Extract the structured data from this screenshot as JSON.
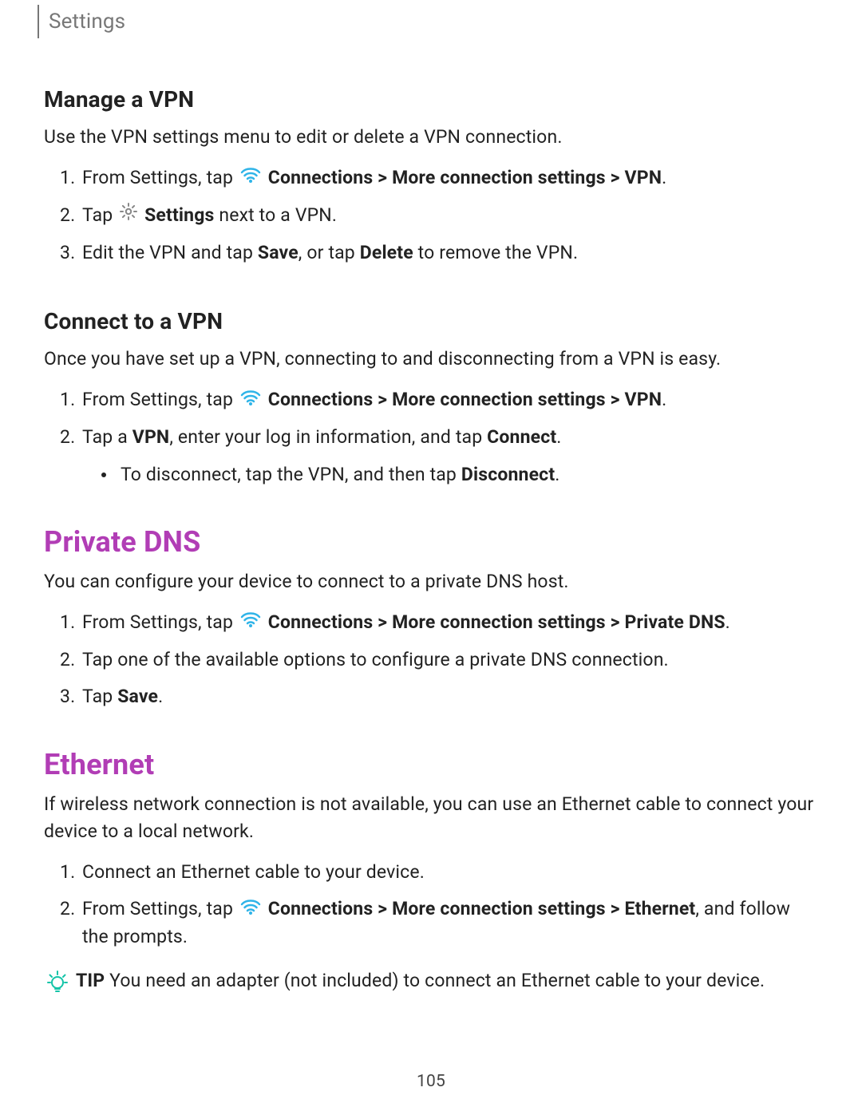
{
  "header": {
    "title": "Settings"
  },
  "manage_vpn": {
    "heading": "Manage a VPN",
    "intro": "Use the VPN settings menu to edit or delete a VPN connection.",
    "step1_a": "From  Settings, tap ",
    "step1_b": " Connections > More connection settings > VPN",
    "step1_c": ".",
    "step2_a": "Tap ",
    "step2_b": " Settings",
    "step2_c": " next to a VPN.",
    "step3_a": "Edit the VPN and tap ",
    "step3_b": "Save",
    "step3_c": ", or tap ",
    "step3_d": "Delete",
    "step3_e": " to remove the VPN."
  },
  "connect_vpn": {
    "heading": "Connect to a VPN",
    "intro": "Once you have set up a VPN, connecting to and disconnecting from a VPN is easy.",
    "step1_a": "From  Settings, tap ",
    "step1_b": " Connections > More connection settings > VPN",
    "step1_c": ".",
    "step2_a": "Tap a ",
    "step2_b": "VPN",
    "step2_c": ", enter your log in information, and tap ",
    "step2_d": "Connect",
    "step2_e": ".",
    "sub_a": "To disconnect, tap the VPN, and then tap ",
    "sub_b": "Disconnect",
    "sub_c": "."
  },
  "private_dns": {
    "heading": "Private DNS",
    "intro": "You can configure your device to connect to a private DNS host.",
    "step1_a": "From Settings, tap ",
    "step1_b": " Connections > More connection settings > Private DNS",
    "step1_c": ".",
    "step2": "Tap one of the available options to configure a private DNS connection.",
    "step3_a": "Tap ",
    "step3_b": "Save",
    "step3_c": "."
  },
  "ethernet": {
    "heading": "Ethernet",
    "intro": "If wireless network connection is not available, you can use an Ethernet cable to connect your device to a local network.",
    "step1": "Connect an Ethernet cable to your device.",
    "step2_a": "From Settings, tap ",
    "step2_b": " Connections > More connection settings > Ethernet",
    "step2_c": ", and follow the prompts.",
    "tip_label": "TIP",
    "tip_text": "  You need an adapter (not included) to connect an Ethernet cable to your device."
  },
  "page": "105"
}
